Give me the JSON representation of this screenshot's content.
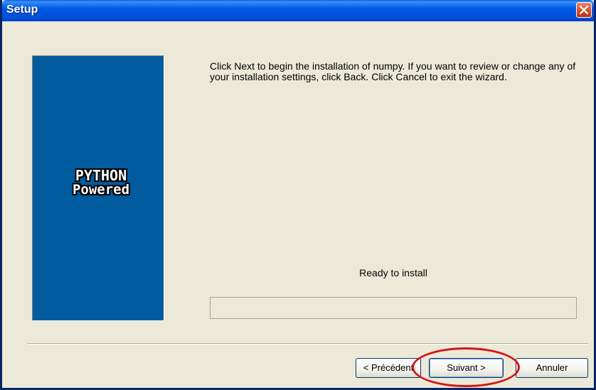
{
  "window": {
    "title": "Setup",
    "close_icon": "close-icon"
  },
  "banner": {
    "logo_line1": "PYTHON",
    "logo_line2": "Powered",
    "background_color": "#005c9e"
  },
  "content": {
    "instructions": "Click Next to begin the installation of numpy. If you want to review or change any of your  installation settings, click Back. Click Cancel to exit the wizard.",
    "status": "Ready to install",
    "progress_fraction": 0
  },
  "buttons": {
    "back": "< Précédent",
    "next": "Suivant >",
    "cancel": "Annuler"
  },
  "colors": {
    "titlebar": "#0058e6",
    "annotation": "#d01818"
  }
}
